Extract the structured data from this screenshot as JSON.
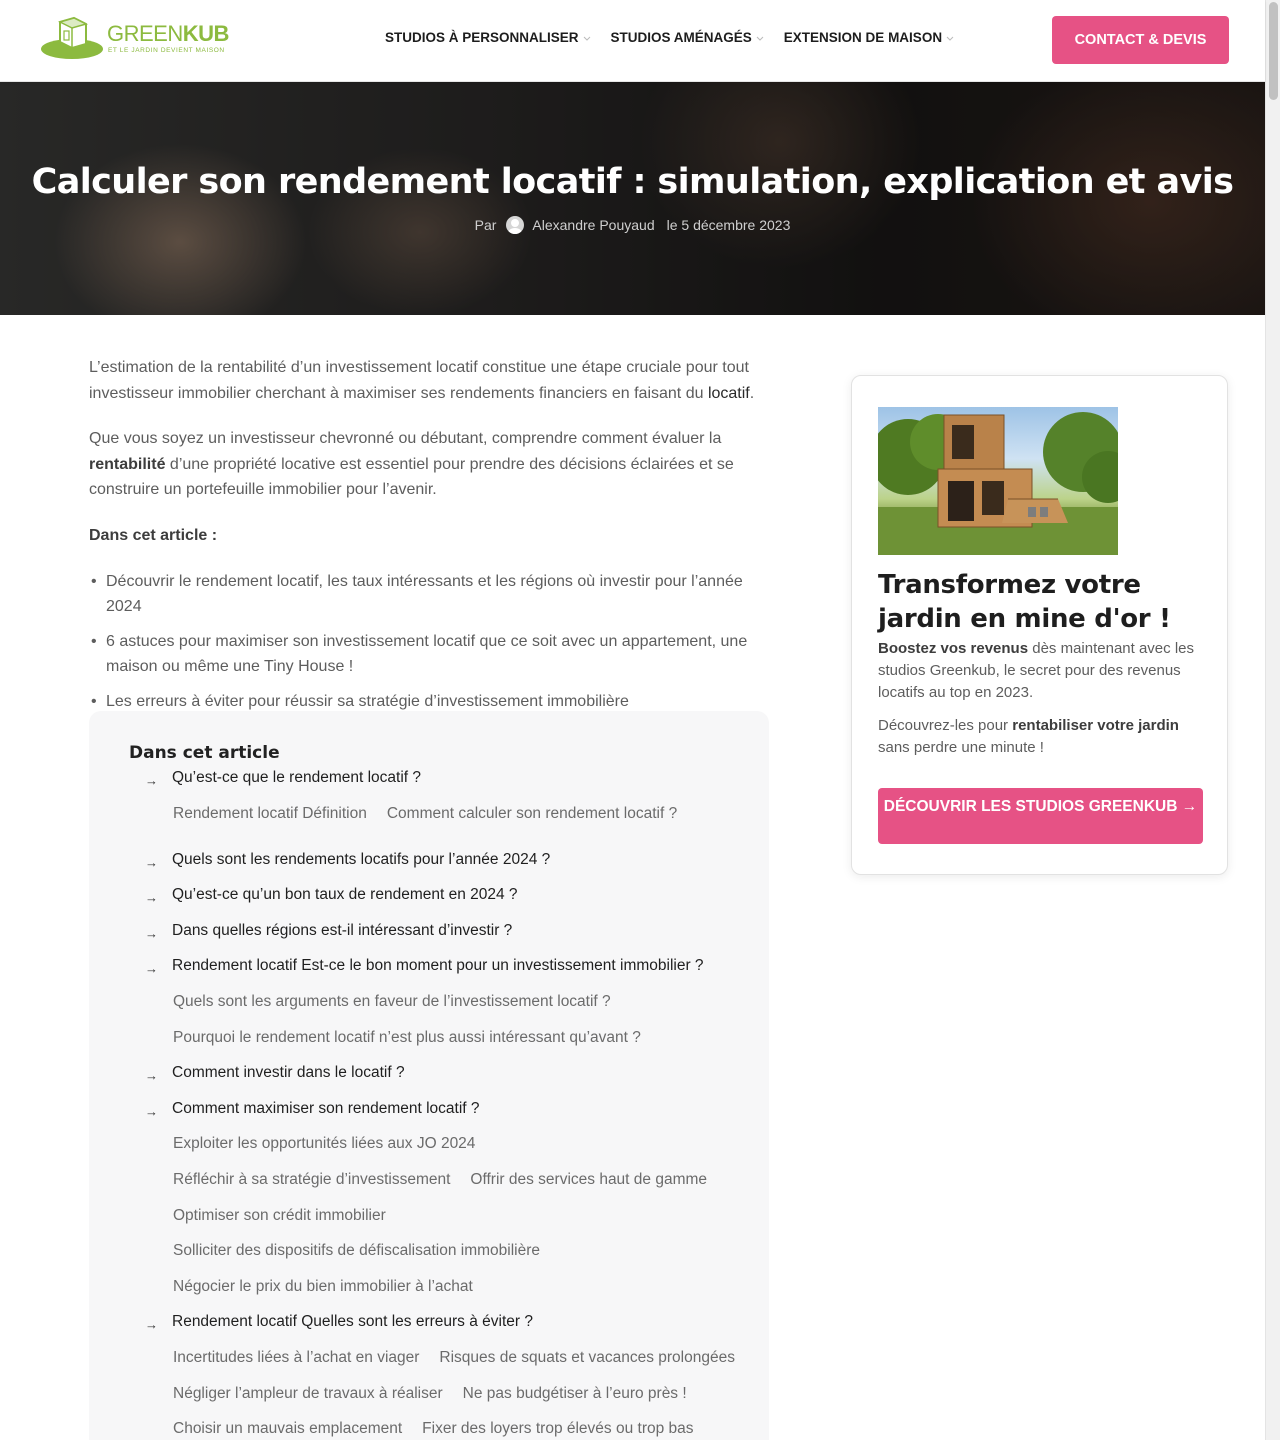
{
  "header": {
    "logo_text_a": "GREEN",
    "logo_text_b": "KUB",
    "logo_tagline": "ET LE JARDIN DEVIENT MAISON",
    "nav": [
      {
        "label": "STUDIOS À PERSONNALISER"
      },
      {
        "label": "STUDIOS AMÉNAGÉS"
      },
      {
        "label": "EXTENSION DE MAISON"
      }
    ],
    "cta_label": "CONTACT & DEVIS"
  },
  "hero": {
    "title": "Calculer son rendement locatif : simulation, explication et avis",
    "by": "Par",
    "author": "Alexandre Pouyaud",
    "date": "le 5 décembre 2023"
  },
  "article": {
    "p1_a": "L’estimation de la rentabilité d’un investissement locatif constitue une étape cruciale pour tout investisseur immobilier cherchant à maximiser ses rendements financiers en faisant du ",
    "p1_link": "locatif",
    "p1_b": ".",
    "p2_a": "Que vous soyez un investisseur chevronné ou débutant, comprendre comment évaluer la ",
    "p2_strong": "rentabilité",
    "p2_b": " d’une propriété locative est essentiel pour prendre des décisions éclairées et se construire un portefeuille immobilier pour l’avenir.",
    "in_article": "Dans cet article :",
    "bullets": [
      "Découvrir le rendement locatif, les taux intéressants et les régions où investir pour l’année 2024",
      "6 astuces pour maximiser son investissement locatif que ce soit avec un appartement, une maison ou même une Tiny House !",
      "Les erreurs à éviter pour réussir sa stratégie d’investissement immobilière"
    ]
  },
  "toc": {
    "title": "Dans cet article",
    "arrow": "→",
    "items": [
      "Qu’est-ce que le rendement locatif ?",
      "Quels sont les rendements locatifs pour l’année 2024 ?",
      "Qu’est-ce qu’un bon taux de rendement en 2024 ?",
      "Dans quelles régions est-il intéressant d’investir ?",
      "Rendement locatif Est-ce le bon moment pour un investissement immobilier ?",
      "Comment investir dans le locatif ?",
      "Comment maximiser son rendement locatif ?",
      "Rendement locatif Quelles sont les erreurs à éviter ?"
    ],
    "subs": [
      [
        "Rendement locatif Définition",
        "Comment calculer son rendement locatif ?"
      ],
      [
        "Quels sont les arguments en faveur de l’investissement locatif ?"
      ],
      [
        "Pourquoi le rendement locatif n’est plus aussi intéressant qu’avant ?"
      ],
      [
        "Exploiter les opportunités liées aux JO 2024"
      ],
      [
        "Réfléchir à sa stratégie d’investissement",
        "Offrir des services haut de gamme"
      ],
      [
        "Optimiser son crédit immobilier"
      ],
      [
        "Solliciter des dispositifs de défiscalisation immobilière"
      ],
      [
        "Négocier le prix du bien immobilier à l’achat"
      ],
      [
        "Incertitudes liées à l’achat en viager",
        "Risques de squats et vacances prolongées"
      ],
      [
        "Négliger l’ampleur de travaux à réaliser",
        "Ne pas budgétiser à l’euro près !"
      ],
      [
        "Choisir un mauvais emplacement",
        "Fixer des loyers trop élevés ou trop bas"
      ]
    ]
  },
  "sidebar": {
    "title": "Transformez votre jardin en mine d'or !",
    "t1_strong": "Boostez vos revenus",
    "t1_rest": " dès maintenant avec les studios Greenkub, le secret pour des revenus locatifs au top en 2023.",
    "t2_a": "Découvrez-les pour ",
    "t2_strong": "rentabiliser votre jardin",
    "t2_b": " sans perdre une minute !",
    "button": "DÉCOUVRIR LES STUDIOS GREENKUB →"
  },
  "colors": {
    "accent": "#e65285",
    "brand_green": "#8cba3f"
  }
}
